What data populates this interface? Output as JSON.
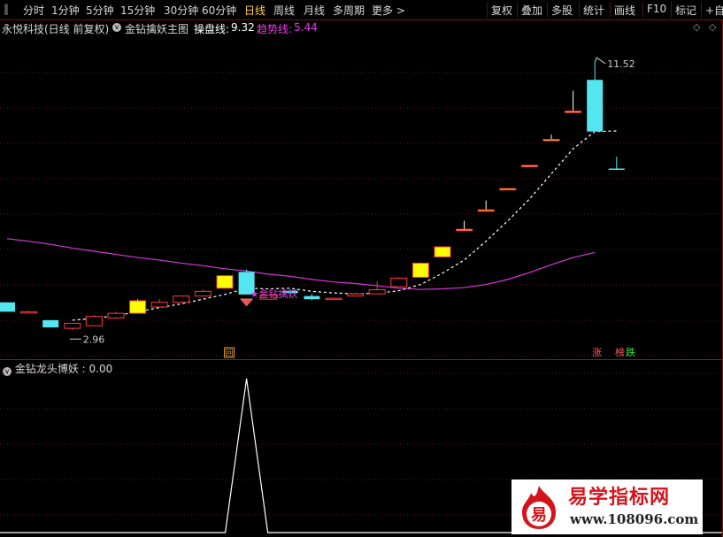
{
  "toolbar": {
    "periods": [
      "分时",
      "1分钟",
      "5分钟",
      "15分钟",
      "30分钟",
      "60分钟",
      "日线",
      "周线",
      "月线",
      "多周期",
      "更多 >"
    ],
    "active_period": "日线",
    "actions": [
      "复权",
      "叠加",
      "多股",
      "统计",
      "画线",
      "F10",
      "标记",
      "+自选"
    ]
  },
  "info": {
    "stock": "永悦科技",
    "mode": "(日线 前复权)",
    "indicator": "金钻擒妖主图",
    "line1_label": "操盘线:",
    "line1_value": "9.32",
    "line2_label": "趋势线:",
    "line2_value": "5.44"
  },
  "annotations": {
    "high": "11.52",
    "low": "2.96",
    "signal": "金钻擒妖",
    "box_mark": "回",
    "zhang": "涨",
    "bang": "榜",
    "die": "跌"
  },
  "indicator_panel": {
    "name": "金钻龙头博妖",
    "value": ": 0.00"
  },
  "watermark": {
    "logo_char": "易",
    "title": "易学指标网",
    "url": "www.108096.com"
  },
  "colors": {
    "up_red": "#ff3b3b",
    "down_cyan": "#54e6f0",
    "yellow": "#ffff00",
    "magenta": "#d63ad6",
    "grid": "#6e0f0f"
  },
  "chart_data": {
    "type": "candlestick",
    "ylim": [
      2.6,
      12.2
    ],
    "candles": [
      {
        "o": 3.85,
        "h": 3.85,
        "l": 3.55,
        "c": 3.55,
        "color": "cyan"
      },
      {
        "o": 3.55,
        "h": 3.58,
        "l": 3.52,
        "c": 3.55,
        "color": "red"
      },
      {
        "o": 3.28,
        "h": 3.28,
        "l": 3.05,
        "c": 3.05,
        "color": "cyan"
      },
      {
        "o": 3.02,
        "h": 3.18,
        "l": 2.96,
        "c": 3.18,
        "color": "red"
      },
      {
        "o": 3.1,
        "h": 3.45,
        "l": 3.1,
        "c": 3.4,
        "color": "red"
      },
      {
        "o": 3.35,
        "h": 3.55,
        "l": 3.35,
        "c": 3.5,
        "color": "red"
      },
      {
        "o": 3.5,
        "h": 3.95,
        "l": 3.5,
        "c": 3.9,
        "color": "yellow"
      },
      {
        "o": 3.7,
        "h": 3.95,
        "l": 3.7,
        "c": 3.85,
        "color": "red"
      },
      {
        "o": 3.85,
        "h": 4.05,
        "l": 3.85,
        "c": 4.05,
        "color": "red"
      },
      {
        "o": 4.05,
        "h": 4.25,
        "l": 4.05,
        "c": 4.2,
        "color": "red"
      },
      {
        "o": 4.3,
        "h": 4.7,
        "l": 4.3,
        "c": 4.7,
        "color": "yellow"
      },
      {
        "o": 4.82,
        "h": 4.9,
        "l": 4.1,
        "c": 4.1,
        "color": "cyan"
      },
      {
        "o": 3.95,
        "h": 4.08,
        "l": 3.95,
        "c": 4.08,
        "color": "red"
      },
      {
        "o": 4.22,
        "h": 4.26,
        "l": 4.12,
        "c": 4.15,
        "color": "cyan"
      },
      {
        "o": 4.05,
        "h": 4.12,
        "l": 3.92,
        "c": 3.95,
        "color": "cyan"
      },
      {
        "o": 3.95,
        "h": 4.0,
        "l": 3.92,
        "c": 3.98,
        "color": "red"
      },
      {
        "o": 4.05,
        "h": 4.15,
        "l": 4.05,
        "c": 4.12,
        "color": "red"
      },
      {
        "o": 4.12,
        "h": 4.52,
        "l": 4.12,
        "c": 4.25,
        "color": "red"
      },
      {
        "o": 4.35,
        "h": 4.65,
        "l": 4.35,
        "c": 4.62,
        "color": "red"
      },
      {
        "o": 4.65,
        "h": 5.12,
        "l": 4.65,
        "c": 5.1,
        "color": "yellow"
      },
      {
        "o": 5.3,
        "h": 5.62,
        "l": 5.3,
        "c": 5.62,
        "color": "yellow"
      },
      {
        "o": 6.18,
        "h": 6.45,
        "l": 6.18,
        "c": 6.18,
        "color": "yellow"
      },
      {
        "o": 6.8,
        "h": 7.1,
        "l": 6.8,
        "c": 6.8,
        "color": "yellow"
      },
      {
        "o": 7.48,
        "h": 7.48,
        "l": 7.48,
        "c": 7.48,
        "color": "yellow"
      },
      {
        "o": 8.22,
        "h": 8.22,
        "l": 8.22,
        "c": 8.22,
        "color": "yellow"
      },
      {
        "o": 9.05,
        "h": 9.2,
        "l": 9.05,
        "c": 9.05,
        "color": "yellow"
      },
      {
        "o": 9.95,
        "h": 10.6,
        "l": 9.95,
        "c": 9.95,
        "color": "yellow"
      },
      {
        "o": 9.3,
        "h": 11.52,
        "l": 9.3,
        "c": 10.95,
        "color": "cyan"
      },
      {
        "o": 8.12,
        "h": 8.5,
        "l": 8.1,
        "c": 8.12,
        "color": "cyan"
      }
    ],
    "line1": [
      null,
      null,
      null,
      3.28,
      3.34,
      3.42,
      3.55,
      3.68,
      3.8,
      3.95,
      4.1,
      4.3,
      4.28,
      4.3,
      4.2,
      4.15,
      4.12,
      4.14,
      4.22,
      4.42,
      4.78,
      5.2,
      5.8,
      6.45,
      7.15,
      7.95,
      8.75,
      9.3,
      9.32
    ],
    "line2": [
      5.88,
      5.8,
      5.7,
      5.58,
      5.48,
      5.38,
      5.28,
      5.2,
      5.1,
      5.02,
      4.92,
      4.85,
      4.75,
      4.68,
      4.58,
      4.5,
      4.45,
      4.38,
      4.3,
      4.26,
      4.28,
      4.32,
      4.42,
      4.58,
      4.8,
      5.05,
      5.28,
      5.44
    ],
    "indicator_spike": {
      "x_index": 11,
      "value": 1
    }
  }
}
